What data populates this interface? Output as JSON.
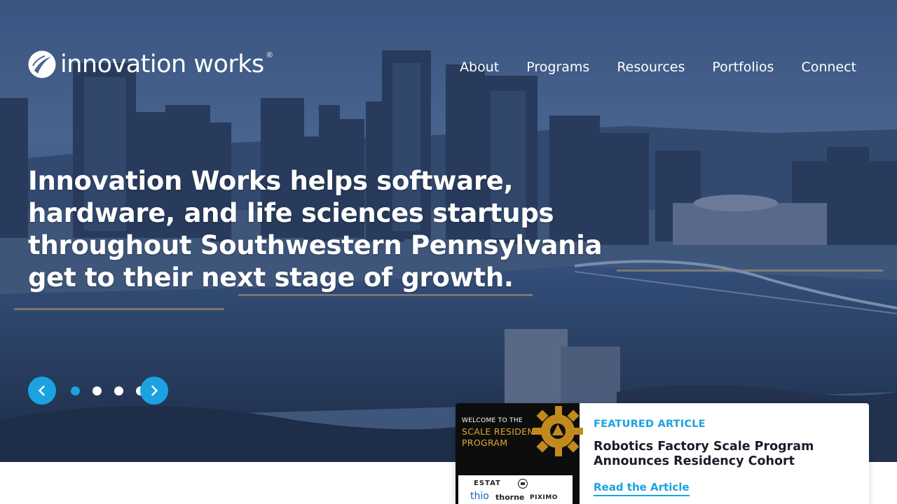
{
  "brand": {
    "name": "innovation works",
    "registered": "®"
  },
  "nav": [
    {
      "label": "About"
    },
    {
      "label": "Programs"
    },
    {
      "label": "Resources"
    },
    {
      "label": "Portfolios"
    },
    {
      "label": "Connect"
    }
  ],
  "hero": {
    "headline": "Innovation Works helps software, hardware, and life sciences startups throughout Southwestern Pennsylvania get to their next stage of growth.",
    "slides_total": 4,
    "active_slide": 1
  },
  "featured": {
    "label": "FEATURED ARTICLE",
    "title": "Robotics Factory Scale Program Announces Residency Cohort",
    "link_label": "Read the Article",
    "thumbnail": {
      "small_text": "WELCOME TO THE",
      "title_line1": "SCALE RESIDENCY",
      "title_line2": "PROGRAM",
      "sponsors": [
        "ESTAT",
        "thio",
        "thorne",
        "PIXIMO"
      ]
    }
  },
  "colors": {
    "accent": "#1aa3e0",
    "card_title": "#1c1c2b",
    "thumb_gold": "#e3a832"
  }
}
